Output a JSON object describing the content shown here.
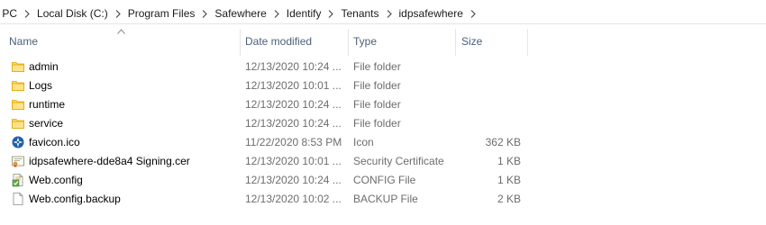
{
  "breadcrumb": {
    "items": [
      "s PC",
      "Local Disk (C:)",
      "Program Files",
      "Safewhere",
      "Identify",
      "Tenants",
      "idpsafewhere"
    ]
  },
  "columns": {
    "name": "Name",
    "date_modified": "Date modified",
    "type": "Type",
    "size": "Size"
  },
  "files": [
    {
      "name": "admin",
      "date": "12/13/2020 10:24 ...",
      "type": "File folder",
      "size": "",
      "icon": "folder-icon"
    },
    {
      "name": "Logs",
      "date": "12/13/2020 10:01 ...",
      "type": "File folder",
      "size": "",
      "icon": "folder-icon"
    },
    {
      "name": "runtime",
      "date": "12/13/2020 10:24 ...",
      "type": "File folder",
      "size": "",
      "icon": "folder-icon"
    },
    {
      "name": "service",
      "date": "12/13/2020 10:24 ...",
      "type": "File folder",
      "size": "",
      "icon": "folder-icon"
    },
    {
      "name": "favicon.ico",
      "date": "11/22/2020 8:53 PM",
      "type": "Icon",
      "size": "362 KB",
      "icon": "favicon-icon"
    },
    {
      "name": "idpsafewhere-dde8a4 Signing.cer",
      "date": "12/13/2020 10:01 ...",
      "type": "Security Certificate",
      "size": "1 KB",
      "icon": "certificate-icon"
    },
    {
      "name": "Web.config",
      "date": "12/13/2020 10:24 ...",
      "type": "CONFIG File",
      "size": "1 KB",
      "icon": "config-file-icon"
    },
    {
      "name": "Web.config.backup",
      "date": "12/13/2020 10:02 ...",
      "type": "BACKUP File",
      "size": "2 KB",
      "icon": "blank-file-icon"
    }
  ],
  "colors": {
    "folder": "#ffd764",
    "folder_dark": "#e0a800",
    "header_text": "#4c607a",
    "detail_text": "#6d6d6d"
  }
}
